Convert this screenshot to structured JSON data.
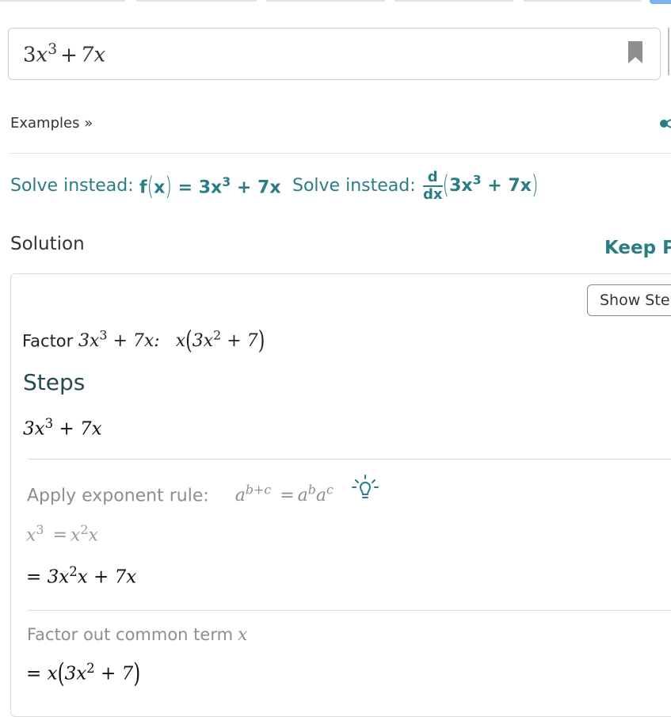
{
  "input": {
    "coef": "3",
    "var": "x",
    "exp": "3",
    "plus": "+",
    "term2": "7x"
  },
  "examples_label": "Examples »",
  "solve_instead": {
    "label": "Solve instead:",
    "alt1": {
      "fx": "f",
      "x": "x",
      "eq": "= 3x",
      "exp": "3",
      "rest": "+ 7x"
    },
    "alt2": {
      "num": "d",
      "den": "dx",
      "inner": "3x",
      "exp": "3",
      "rest": "+ 7x"
    }
  },
  "solution_label": "Solution",
  "keep_practicing": "Keep P",
  "show_steps": "Show Steps",
  "factor": {
    "word": "Factor",
    "expr": "3x",
    "expr_exp": "3",
    "expr_rest": "+ 7x:",
    "result_x": "x",
    "result_inner": "3x",
    "result_exp": "2",
    "result_rest": "+ 7"
  },
  "steps_title": "Steps",
  "step0": {
    "coef": "3x",
    "exp": "3",
    "rest": "+ 7x"
  },
  "exponent_rule": {
    "label": "Apply exponent rule:",
    "base": "a",
    "exp": "b+c",
    "eq": "=",
    "r1": "a",
    "r1exp": "b",
    "r2": "a",
    "r2exp": "c"
  },
  "substep": {
    "lhs": "x",
    "lhs_exp": "3",
    "eq": "=",
    "r1": "x",
    "r1exp": "2",
    "r2": "x"
  },
  "result1": {
    "eq": "=",
    "coef": "3x",
    "exp": "2",
    "rest": "x + 7x"
  },
  "factor_out": {
    "label": "Factor out common term",
    "var": "x"
  },
  "result2": {
    "eq": "=",
    "x": "x",
    "inner": "3x",
    "exp": "2",
    "rest": "+ 7"
  },
  "colors": {
    "accent": "#2b7d85",
    "tab_active": "#7db0ec"
  }
}
